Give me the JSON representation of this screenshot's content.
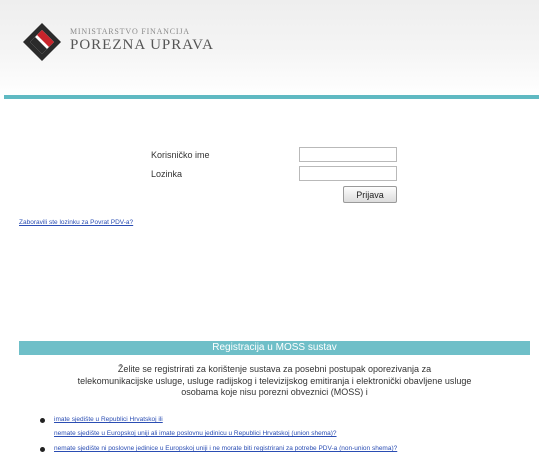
{
  "header": {
    "ministry": "MINISTARSTVO FINANCIJA",
    "agency": "POREZNA UPRAVA"
  },
  "login": {
    "username_label": "Korisničko ime",
    "username_value": "",
    "password_label": "Lozinka",
    "password_value": "",
    "submit_label": "Prijava",
    "forgot_link": "Zaboravili ste lozinku za Povrat PDV-a?"
  },
  "moss": {
    "title": "Registracija u MOSS sustav",
    "description_lines": [
      "Želite se registrirati za korištenje sustava za posebni postupak oporezivanja za",
      "telekomunikacijske usluge, usluge radijskog i televizijskog emitiranja i elektronički obavljene usluge",
      "osobama koje nisu porezni obveznici (MOSS) i"
    ],
    "options": [
      "imate sjedište u Republici Hrvatskoj ili",
      "nemate sjedište u Europskoj uniji ali imate poslovnu jedinicu u Republici Hrvatskoj (union shema)?",
      "nemate sjedište ni poslovne jedinice u Europskoj uniji i ne morate biti registrirani za potrebe PDV-a (non-union shema)?"
    ]
  },
  "colors": {
    "accent": "#5fb9c2",
    "moss_bar": "#6fbfc8",
    "link": "#2a4db3"
  },
  "icons": {
    "logo": "porezna-uprava-diamond-logo"
  }
}
